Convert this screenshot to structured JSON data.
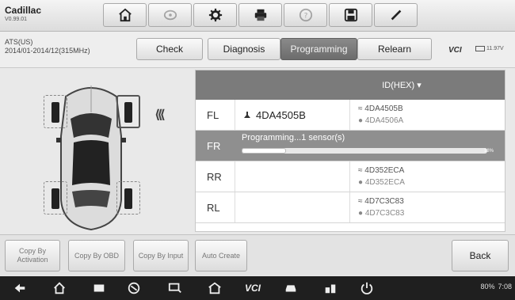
{
  "brand": {
    "name": "Cadillac",
    "version": "V0.99.01"
  },
  "vehicle": {
    "line1": "ATS(US)",
    "line2": "2014/01-2014/12(315MHz)"
  },
  "tabs": [
    {
      "label": "Check",
      "active": false
    },
    {
      "label": "Diagnosis",
      "active": false
    },
    {
      "label": "Programming",
      "active": true
    },
    {
      "label": "Relearn",
      "active": false
    }
  ],
  "vci_label": "VCI",
  "battery_voltage": "11.97V",
  "toolbar_icons": [
    "home-icon",
    "wheel-icon",
    "gear-icon",
    "printer-icon",
    "help-icon",
    "save-icon",
    "pen-icon"
  ],
  "table": {
    "header": "ID(HEX)",
    "rows": [
      {
        "pos": "FL",
        "id": "4DA4505B",
        "val1": "4DA4505B",
        "val2": "4DA4506A"
      },
      {
        "pos": "FR",
        "progress_text": "Programming...1 sensor(s)",
        "progress": 0.18,
        "progress_label": "18%"
      },
      {
        "pos": "RR",
        "id": "",
        "val1": "4D352ECA",
        "val2": "4D352ECA"
      },
      {
        "pos": "RL",
        "id": "",
        "val1": "4D7C3C83",
        "val2": "4D7C3C83"
      }
    ]
  },
  "bottom": {
    "copy_activation": "Copy By Activation",
    "copy_obd": "Copy By OBD",
    "copy_input": "Copy By Input",
    "auto_create": "Auto Create",
    "back": "Back"
  },
  "status_bar": {
    "battery": "80%",
    "time": "7:08"
  },
  "colors": {
    "progress_row": "#8f8f8f",
    "header": "#7b7b7b",
    "active_tab": "#777777"
  }
}
